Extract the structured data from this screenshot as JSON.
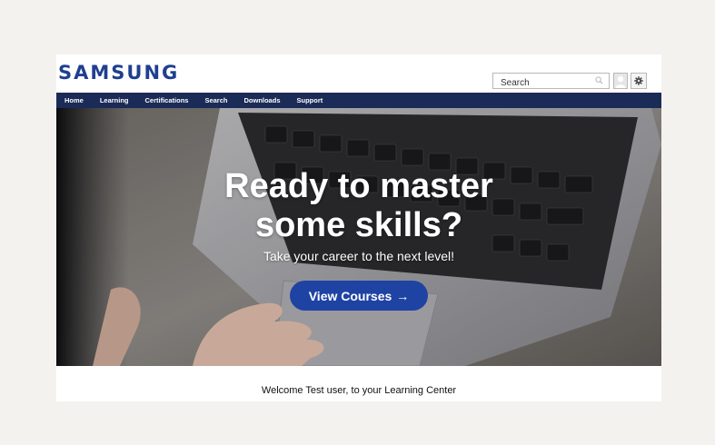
{
  "brand": {
    "logo_text": "SAMSUNG",
    "color": "#1f3f8f"
  },
  "header": {
    "search_placeholder": "Search",
    "search_icon": "search-icon",
    "avatar_icon": "user-avatar-icon",
    "settings_icon": "gear-icon"
  },
  "nav": {
    "background": "#1b2b57",
    "items": [
      {
        "label": "Home"
      },
      {
        "label": "Learning"
      },
      {
        "label": "Certifications"
      },
      {
        "label": "Search"
      },
      {
        "label": "Downloads"
      },
      {
        "label": "Support"
      }
    ]
  },
  "hero": {
    "headline_line1": "Ready to master",
    "headline_line2": "some skills?",
    "subheadline": "Take your career to the next level!",
    "cta_label": "View Courses",
    "cta_arrow": "→",
    "cta_color": "#1f43a3"
  },
  "footer": {
    "welcome_text": "Welcome Test user, to your Learning Center"
  }
}
